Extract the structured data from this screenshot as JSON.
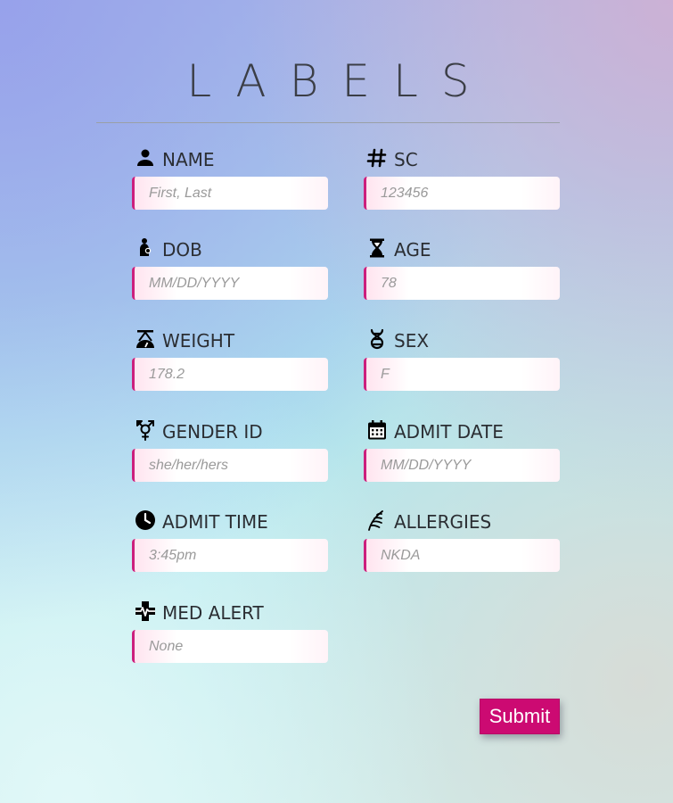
{
  "title": "LABELS",
  "fields": {
    "name": {
      "label": "NAME",
      "placeholder": "First, Last",
      "icon": "person-icon"
    },
    "sc": {
      "label": "SC",
      "placeholder": "123456",
      "icon": "hash-icon"
    },
    "dob": {
      "label": "DOB",
      "placeholder": "MM/DD/YYYY",
      "icon": "baby-icon"
    },
    "age": {
      "label": "AGE",
      "placeholder": "78",
      "icon": "hourglass-icon"
    },
    "weight": {
      "label": "WEIGHT",
      "placeholder": "178.2",
      "icon": "scale-icon"
    },
    "sex": {
      "label": "SEX",
      "placeholder": "F",
      "icon": "dna-icon"
    },
    "gender_id": {
      "label": "GENDER ID",
      "placeholder": "she/her/hers",
      "icon": "transgender-icon"
    },
    "admit_date": {
      "label": "ADMIT DATE",
      "placeholder": "MM/DD/YYYY",
      "icon": "calendar-icon"
    },
    "admit_time": {
      "label": "ADMIT TIME",
      "placeholder": "3:45pm",
      "icon": "clock-icon"
    },
    "allergies": {
      "label": "ALLERGIES",
      "placeholder": "NKDA",
      "icon": "allergy-icon"
    },
    "med_alert": {
      "label": "MED ALERT",
      "placeholder": "None",
      "icon": "medical-cross-icon"
    }
  },
  "submit_label": "Submit",
  "colors": {
    "accent": "#cc0a72",
    "input_border": "#cc1f7d",
    "label_text": "#2b2e33"
  }
}
